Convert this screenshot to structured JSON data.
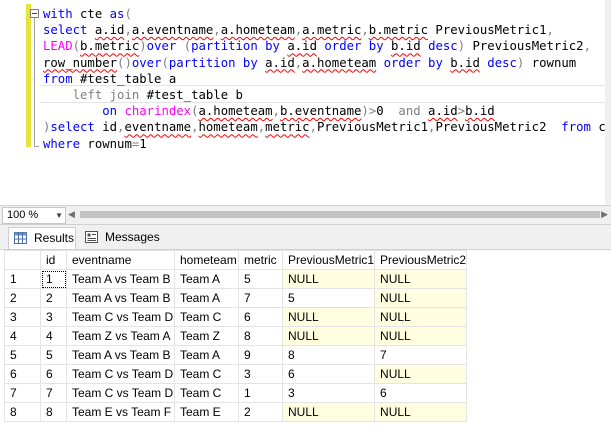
{
  "editor": {
    "lines": [
      [
        [
          "kw",
          "with"
        ],
        [
          "t",
          " cte "
        ],
        [
          "kw",
          "as"
        ],
        [
          "op",
          "("
        ]
      ],
      [
        [
          "kw",
          "select"
        ],
        [
          "t",
          " "
        ],
        [
          "sq",
          "a.id"
        ],
        [
          "op",
          ","
        ],
        [
          "sq",
          "a.eventname"
        ],
        [
          "op",
          ","
        ],
        [
          "sq",
          "a.hometeam"
        ],
        [
          "op",
          ","
        ],
        [
          "sq",
          "a.metric"
        ],
        [
          "op",
          ","
        ],
        [
          "sq",
          "b.metric"
        ],
        [
          "t",
          " PreviousMetric1"
        ],
        [
          "op",
          ","
        ]
      ],
      [
        [
          "fn",
          "LEAD"
        ],
        [
          "op",
          "("
        ],
        [
          "sq",
          "b.metric"
        ],
        [
          "op",
          ")"
        ],
        [
          "kw",
          "over"
        ],
        [
          "t",
          " "
        ],
        [
          "op",
          "("
        ],
        [
          "kw",
          "partition by"
        ],
        [
          "t",
          " "
        ],
        [
          "sq",
          "a.id"
        ],
        [
          "t",
          " "
        ],
        [
          "kw",
          "order by"
        ],
        [
          "t",
          " "
        ],
        [
          "sq",
          "b.id"
        ],
        [
          "t",
          " "
        ],
        [
          "kw",
          "desc"
        ],
        [
          "op",
          ")"
        ],
        [
          "t",
          " PreviousMetric2"
        ],
        [
          "op",
          ","
        ]
      ],
      [
        [
          "sq",
          "row_number"
        ],
        [
          "op",
          "()"
        ],
        [
          "kw",
          "over"
        ],
        [
          "op",
          "("
        ],
        [
          "kw",
          "partition by"
        ],
        [
          "t",
          " "
        ],
        [
          "sq",
          "a.id"
        ],
        [
          "op",
          ","
        ],
        [
          "sq",
          "a.hometeam"
        ],
        [
          "t",
          " "
        ],
        [
          "kw",
          "order by"
        ],
        [
          "t",
          " "
        ],
        [
          "sq",
          "b.id"
        ],
        [
          "t",
          " "
        ],
        [
          "kw",
          "desc"
        ],
        [
          "op",
          ")"
        ],
        [
          "t",
          " rownum"
        ]
      ],
      [
        [
          "kw",
          "from"
        ],
        [
          "t",
          " #test_table a"
        ]
      ],
      [
        [
          "t",
          "    "
        ],
        [
          "op",
          "left join"
        ],
        [
          "t",
          " #test_table b"
        ]
      ],
      [
        [
          "t",
          "        "
        ],
        [
          "kw",
          "on"
        ],
        [
          "t",
          " "
        ],
        [
          "fn",
          "charindex"
        ],
        [
          "op",
          "("
        ],
        [
          "sq",
          "a.hometeam"
        ],
        [
          "op",
          ","
        ],
        [
          "sq",
          "b.eventname"
        ],
        [
          "op",
          ")>"
        ],
        [
          "t",
          "0  "
        ],
        [
          "op",
          "and"
        ],
        [
          "t",
          " "
        ],
        [
          "sq",
          "a.id"
        ],
        [
          "op",
          ">"
        ],
        [
          "sq",
          "b.id"
        ]
      ],
      [
        [
          "op",
          ")"
        ],
        [
          "kw",
          "select"
        ],
        [
          "t",
          " id"
        ],
        [
          "op",
          ","
        ],
        [
          "sq",
          "eventname"
        ],
        [
          "op",
          ","
        ],
        [
          "sq",
          "hometeam"
        ],
        [
          "op",
          ","
        ],
        [
          "sq",
          "metric"
        ],
        [
          "op",
          ","
        ],
        [
          "t",
          "PreviousMetric1"
        ],
        [
          "op",
          ","
        ],
        [
          "t",
          "PreviousMetric2  "
        ],
        [
          "kw",
          "from"
        ],
        [
          "t",
          " cte"
        ]
      ],
      [
        [
          "kw",
          "where"
        ],
        [
          "t",
          " rownum"
        ],
        [
          "op",
          "="
        ],
        [
          "t",
          "1"
        ]
      ]
    ]
  },
  "zoom": {
    "value": "100 %"
  },
  "tabs": {
    "results_label": "Results",
    "messages_label": "Messages"
  },
  "grid": {
    "columns": [
      "id",
      "eventname",
      "hometeam",
      "metric",
      "PreviousMetric1",
      "PreviousMetric2"
    ],
    "rows": [
      [
        "1",
        "1",
        "Team A vs Team B",
        "Team A",
        "5",
        "NULL",
        "NULL"
      ],
      [
        "2",
        "2",
        "Team A vs Team B",
        "Team A",
        "7",
        "5",
        "NULL"
      ],
      [
        "3",
        "3",
        "Team C vs Team D",
        "Team C",
        "6",
        "NULL",
        "NULL"
      ],
      [
        "4",
        "4",
        "Team Z vs Team A",
        "Team Z",
        "8",
        "NULL",
        "NULL"
      ],
      [
        "5",
        "5",
        "Team A vs Team B",
        "Team A",
        "9",
        "8",
        "7"
      ],
      [
        "6",
        "6",
        "Team C vs Team D",
        "Team C",
        "3",
        "6",
        "NULL"
      ],
      [
        "7",
        "7",
        "Team C vs Team D",
        "Team C",
        "1",
        "3",
        "6"
      ],
      [
        "8",
        "8",
        "Team E vs Team F",
        "Team E",
        "2",
        "NULL",
        "NULL"
      ]
    ]
  },
  "colors": {
    "keyword": "#0000ff",
    "function": "#ff00ff",
    "operator": "#808080",
    "null_bg": "#fffee0",
    "marker": "#e8e23c"
  }
}
